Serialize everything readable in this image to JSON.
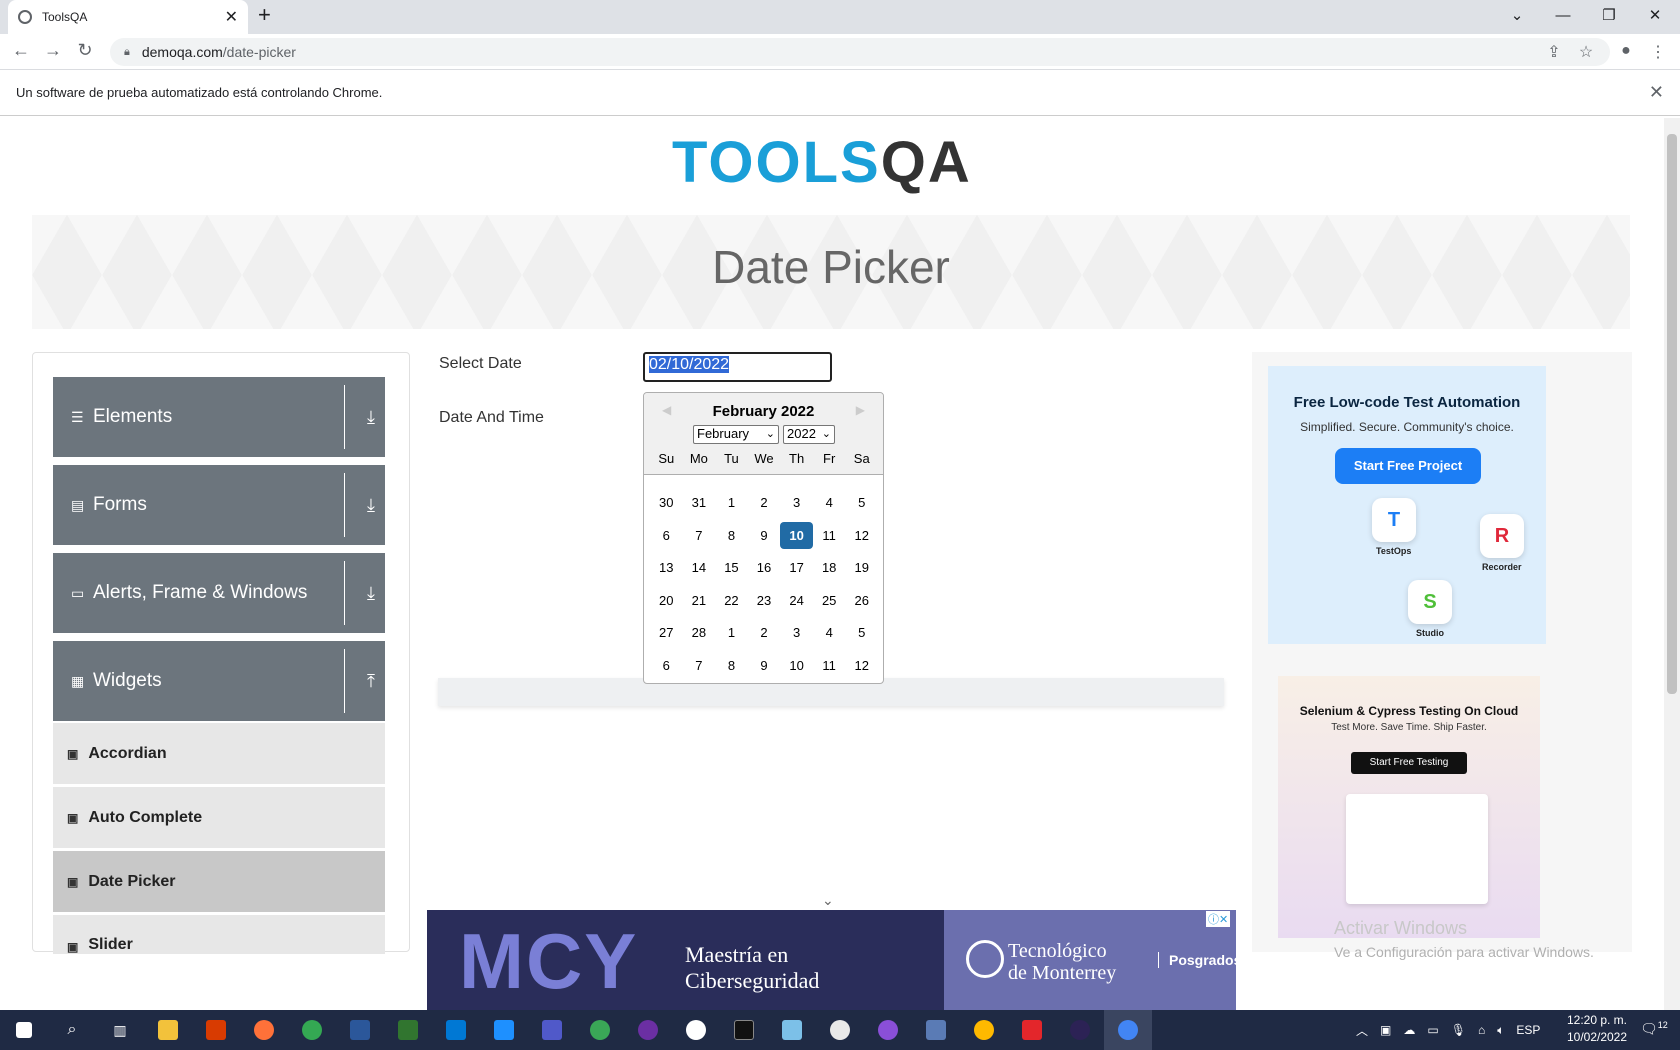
{
  "browser": {
    "tab_title": "ToolsQA",
    "url_host": "demoqa.com",
    "url_path": "/date-picker",
    "infobar_text": "Un software de prueba automatizado está controlando Chrome."
  },
  "page": {
    "logo_main": "TOOLS",
    "logo_accent": "QA",
    "title": "Date Picker"
  },
  "sidebar": {
    "groups": [
      {
        "label": "Elements",
        "icon": "menu-icon"
      },
      {
        "label": "Forms",
        "icon": "form-icon"
      },
      {
        "label": "Alerts, Frame & Windows",
        "icon": "window-icon"
      },
      {
        "label": "Widgets",
        "icon": "grid-icon"
      }
    ],
    "items": [
      {
        "label": "Accordian"
      },
      {
        "label": "Auto Complete"
      },
      {
        "label": "Date Picker",
        "active": true
      },
      {
        "label": "Slider"
      }
    ]
  },
  "form": {
    "select_date_label": "Select Date",
    "date_time_label": "Date And Time",
    "date_value": "02/10/2022"
  },
  "calendar": {
    "title": "February 2022",
    "month_select": "February",
    "year_select": "2022",
    "weekdays": [
      "Su",
      "Mo",
      "Tu",
      "We",
      "Th",
      "Fr",
      "Sa"
    ],
    "weeks": [
      [
        "30",
        "31",
        "1",
        "2",
        "3",
        "4",
        "5"
      ],
      [
        "6",
        "7",
        "8",
        "9",
        "10",
        "11",
        "12"
      ],
      [
        "13",
        "14",
        "15",
        "16",
        "17",
        "18",
        "19"
      ],
      [
        "20",
        "21",
        "22",
        "23",
        "24",
        "25",
        "26"
      ],
      [
        "27",
        "28",
        "1",
        "2",
        "3",
        "4",
        "5"
      ],
      [
        "6",
        "7",
        "8",
        "9",
        "10",
        "11",
        "12"
      ]
    ],
    "selected_day": "10"
  },
  "ads": {
    "ad1": {
      "title": "Free Low-code Test Automation",
      "subtitle": "Simplified. Secure. Community's choice.",
      "button": "Start Free Project",
      "tile_testops": "TestOps",
      "tile_recorder": "Recorder",
      "tile_studio": "Studio"
    },
    "ad2": {
      "title": "Selenium & Cypress Testing On Cloud",
      "subtitle": "Test More. Save Time. Ship Faster.",
      "button": "Start Free Testing"
    },
    "bottom": {
      "brand": "MCY",
      "line1": "Maestría en",
      "line2": "Ciberseguridad",
      "school1": "Tecnológico",
      "school2": "de Monterrey",
      "tag": "Posgrados"
    }
  },
  "watermark": {
    "line1": "Activar Windows",
    "line2": "Ve a Configuración para activar Windows."
  },
  "taskbar": {
    "lang": "ESP",
    "time": "12:20 p. m.",
    "date": "10/02/2022",
    "notifications": "12"
  },
  "colors": {
    "sidebar_group": "#6c757d",
    "calendar_selected": "#216ba5",
    "logo_blue": "#1a9fd8"
  }
}
